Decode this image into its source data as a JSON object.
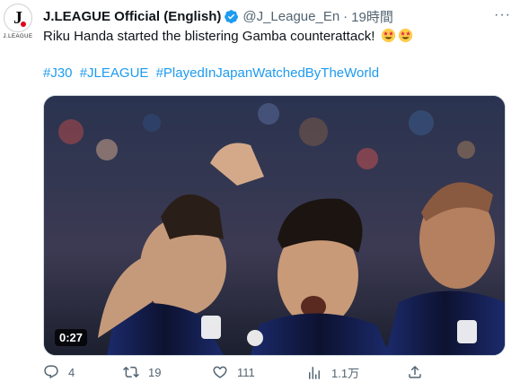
{
  "tweet": {
    "author_name": "J.LEAGUE Official (English)",
    "handle": "@J_League_En",
    "separator": "·",
    "time": "19時間",
    "text": "Riku Handa started the blistering Gamba counterattack!",
    "emoji": [
      "star-struck",
      "star-struck"
    ],
    "hashtags": [
      "#J30",
      "#JLEAGUE",
      "#PlayedInJapanWatchedByTheWorld"
    ],
    "avatar_text": "J.LEAGUE",
    "avatar_mark": "J"
  },
  "media": {
    "duration": "0:27"
  },
  "actions": {
    "replies": "4",
    "retweets": "19",
    "likes": "111",
    "views": "1.1万"
  },
  "colors": {
    "link": "#1d9bf0",
    "verified": "#1d9bf0",
    "muted": "#536471",
    "text": "#0f1419"
  }
}
